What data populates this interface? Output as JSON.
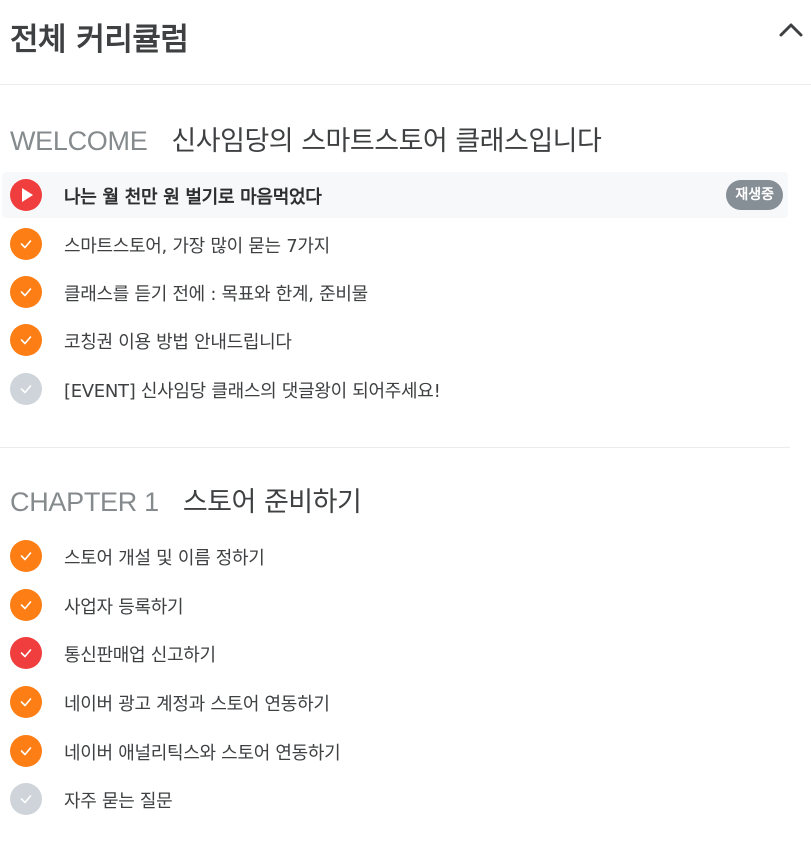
{
  "header": {
    "title": "전체 커리큘럼",
    "collapse_icon": "chevron-up-icon"
  },
  "colors": {
    "completed": "#fd7e14",
    "playing": "#f03e3e",
    "incomplete": "#ced4da",
    "badge": "#868e96"
  },
  "sections": [
    {
      "label": "WELCOME",
      "name": "신사임당의 스마트스토어 클래스입니다",
      "lessons": [
        {
          "title": "나는 월 천만 원 벌기로 마음먹었다",
          "status": "playing",
          "badge": "재생중"
        },
        {
          "title": "스마트스토어, 가장 많이 묻는 7가지",
          "status": "completed"
        },
        {
          "title": "클래스를 듣기 전에 : 목표와 한계, 준비물",
          "status": "completed"
        },
        {
          "title": "코칭권 이용 방법 안내드립니다",
          "status": "completed"
        },
        {
          "title": "[EVENT] 신사임당 클래스의 댓글왕이 되어주세요!",
          "status": "incomplete"
        }
      ]
    },
    {
      "label": "CHAPTER 1",
      "name": "스토어 준비하기",
      "lessons": [
        {
          "title": "스토어 개설 및 이름 정하기",
          "status": "completed"
        },
        {
          "title": "사업자 등록하기",
          "status": "completed"
        },
        {
          "title": "통신판매업 신고하기",
          "status": "completed-highlight"
        },
        {
          "title": "네이버 광고 계정과 스토어 연동하기",
          "status": "completed"
        },
        {
          "title": "네이버 애널리틱스와 스토어 연동하기",
          "status": "completed"
        },
        {
          "title": "자주 묻는 질문",
          "status": "incomplete"
        }
      ]
    }
  ]
}
